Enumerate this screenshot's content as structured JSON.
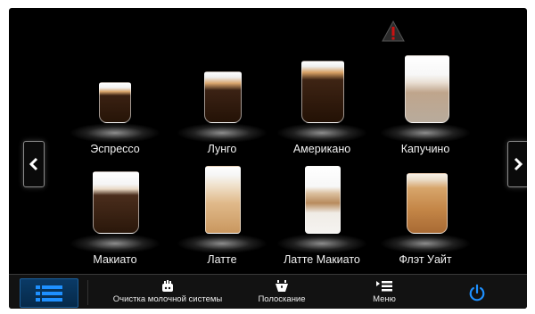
{
  "status": {
    "warning_icon": "warning-triangle-icon",
    "warning_color": "#cc1111"
  },
  "drinks": [
    {
      "label": "Эспрессо",
      "icon": "espresso-cup-icon"
    },
    {
      "label": "Лунго",
      "icon": "lungo-cup-icon"
    },
    {
      "label": "Американо",
      "icon": "americano-cup-icon"
    },
    {
      "label": "Капучино",
      "icon": "cappuccino-cup-icon"
    },
    {
      "label": "Макиато",
      "icon": "macchiato-cup-icon"
    },
    {
      "label": "Латте",
      "icon": "latte-glass-icon"
    },
    {
      "label": "Латте Макиато",
      "icon": "latte-macchiato-glass-icon"
    },
    {
      "label": "Флэт Уайт",
      "icon": "flat-white-cup-icon"
    }
  ],
  "nav": {
    "prev_icon": "chevron-left-icon",
    "next_icon": "chevron-right-icon"
  },
  "bottom_bar": {
    "menu_list_icon": "list-icon",
    "milk_cleaning_label": "Очистка молочной системы",
    "rinse_label": "Полоскание",
    "menu_label": "Меню",
    "power_icon": "power-icon",
    "accent_color": "#1e90ff"
  }
}
